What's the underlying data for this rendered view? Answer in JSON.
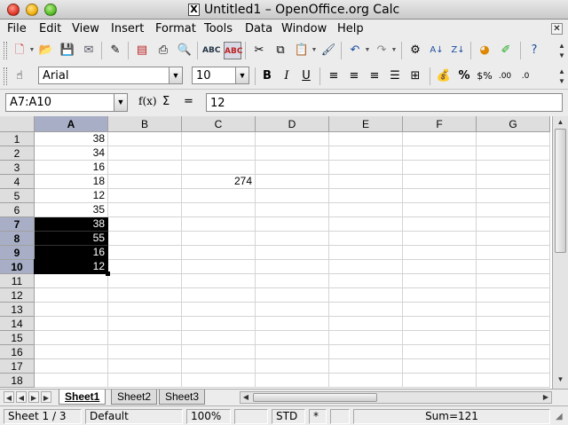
{
  "window": {
    "title": "Untitled1 – OpenOffice.org Calc"
  },
  "menu": [
    "File",
    "Edit",
    "View",
    "Insert",
    "Format",
    "Tools",
    "Data",
    "Window",
    "Help"
  ],
  "toolbar": {
    "font_name": "Arial",
    "font_size": "10"
  },
  "formula_bar": {
    "name_box": "A7:A10",
    "fx_label": "f(x)",
    "sum_label": "Σ",
    "equals_label": "=",
    "content": "12"
  },
  "grid": {
    "columns": [
      "A",
      "B",
      "C",
      "D",
      "E",
      "F",
      "G"
    ],
    "rows": [
      "1",
      "2",
      "3",
      "4",
      "5",
      "6",
      "7",
      "8",
      "9",
      "10",
      "11",
      "12",
      "13",
      "14",
      "15",
      "16",
      "17",
      "18"
    ],
    "column_a": [
      "38",
      "34",
      "16",
      "18",
      "12",
      "35",
      "38",
      "55",
      "16",
      "12"
    ],
    "c4": "274",
    "selected_column": "A",
    "selected_rows": [
      "7",
      "8",
      "9",
      "10"
    ]
  },
  "sheets": [
    "Sheet1",
    "Sheet2",
    "Sheet3"
  ],
  "active_sheet": "Sheet1",
  "status": {
    "sheet": "Sheet 1 / 3",
    "style": "Default",
    "zoom": "100%",
    "mode": "STD",
    "modified": "*",
    "sum": "Sum=121"
  },
  "colors": {
    "header_selected": "#a7aec6",
    "selection": "#000000"
  }
}
